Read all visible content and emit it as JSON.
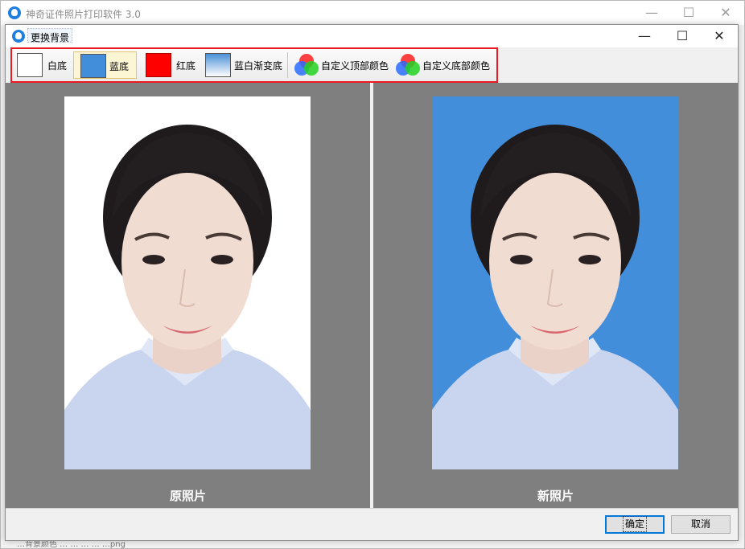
{
  "outer_window": {
    "title": "神奇证件照片打印软件 3.0",
    "status_text": "…背景颜色 …  …  …  …  …png",
    "controls": {
      "minimize": "—",
      "maximize": "☐",
      "close": "✕"
    }
  },
  "dialog": {
    "title": "更换背景",
    "controls": {
      "minimize": "—",
      "maximize": "☐",
      "close": "✕"
    },
    "toolbar": {
      "items": [
        {
          "label": "白底",
          "color": "#ffffff"
        },
        {
          "label": "蓝底",
          "color": "#438edb",
          "selected": true
        },
        {
          "label": "红底",
          "color": "#ff0000"
        },
        {
          "label": "蓝白渐变底",
          "color_top": "#4a8fd6",
          "color_bottom": "#ffffff"
        },
        {
          "label": "自定义顶部颜色",
          "icon": "rgb-circles-icon"
        },
        {
          "label": "自定义底部颜色",
          "icon": "rgb-circles-icon"
        }
      ]
    },
    "preview": {
      "original_caption": "原照片",
      "new_caption": "新照片",
      "original_bg": "#ffffff",
      "new_bg": "#438edb"
    },
    "buttons": {
      "ok": "确定",
      "cancel": "取消"
    }
  }
}
